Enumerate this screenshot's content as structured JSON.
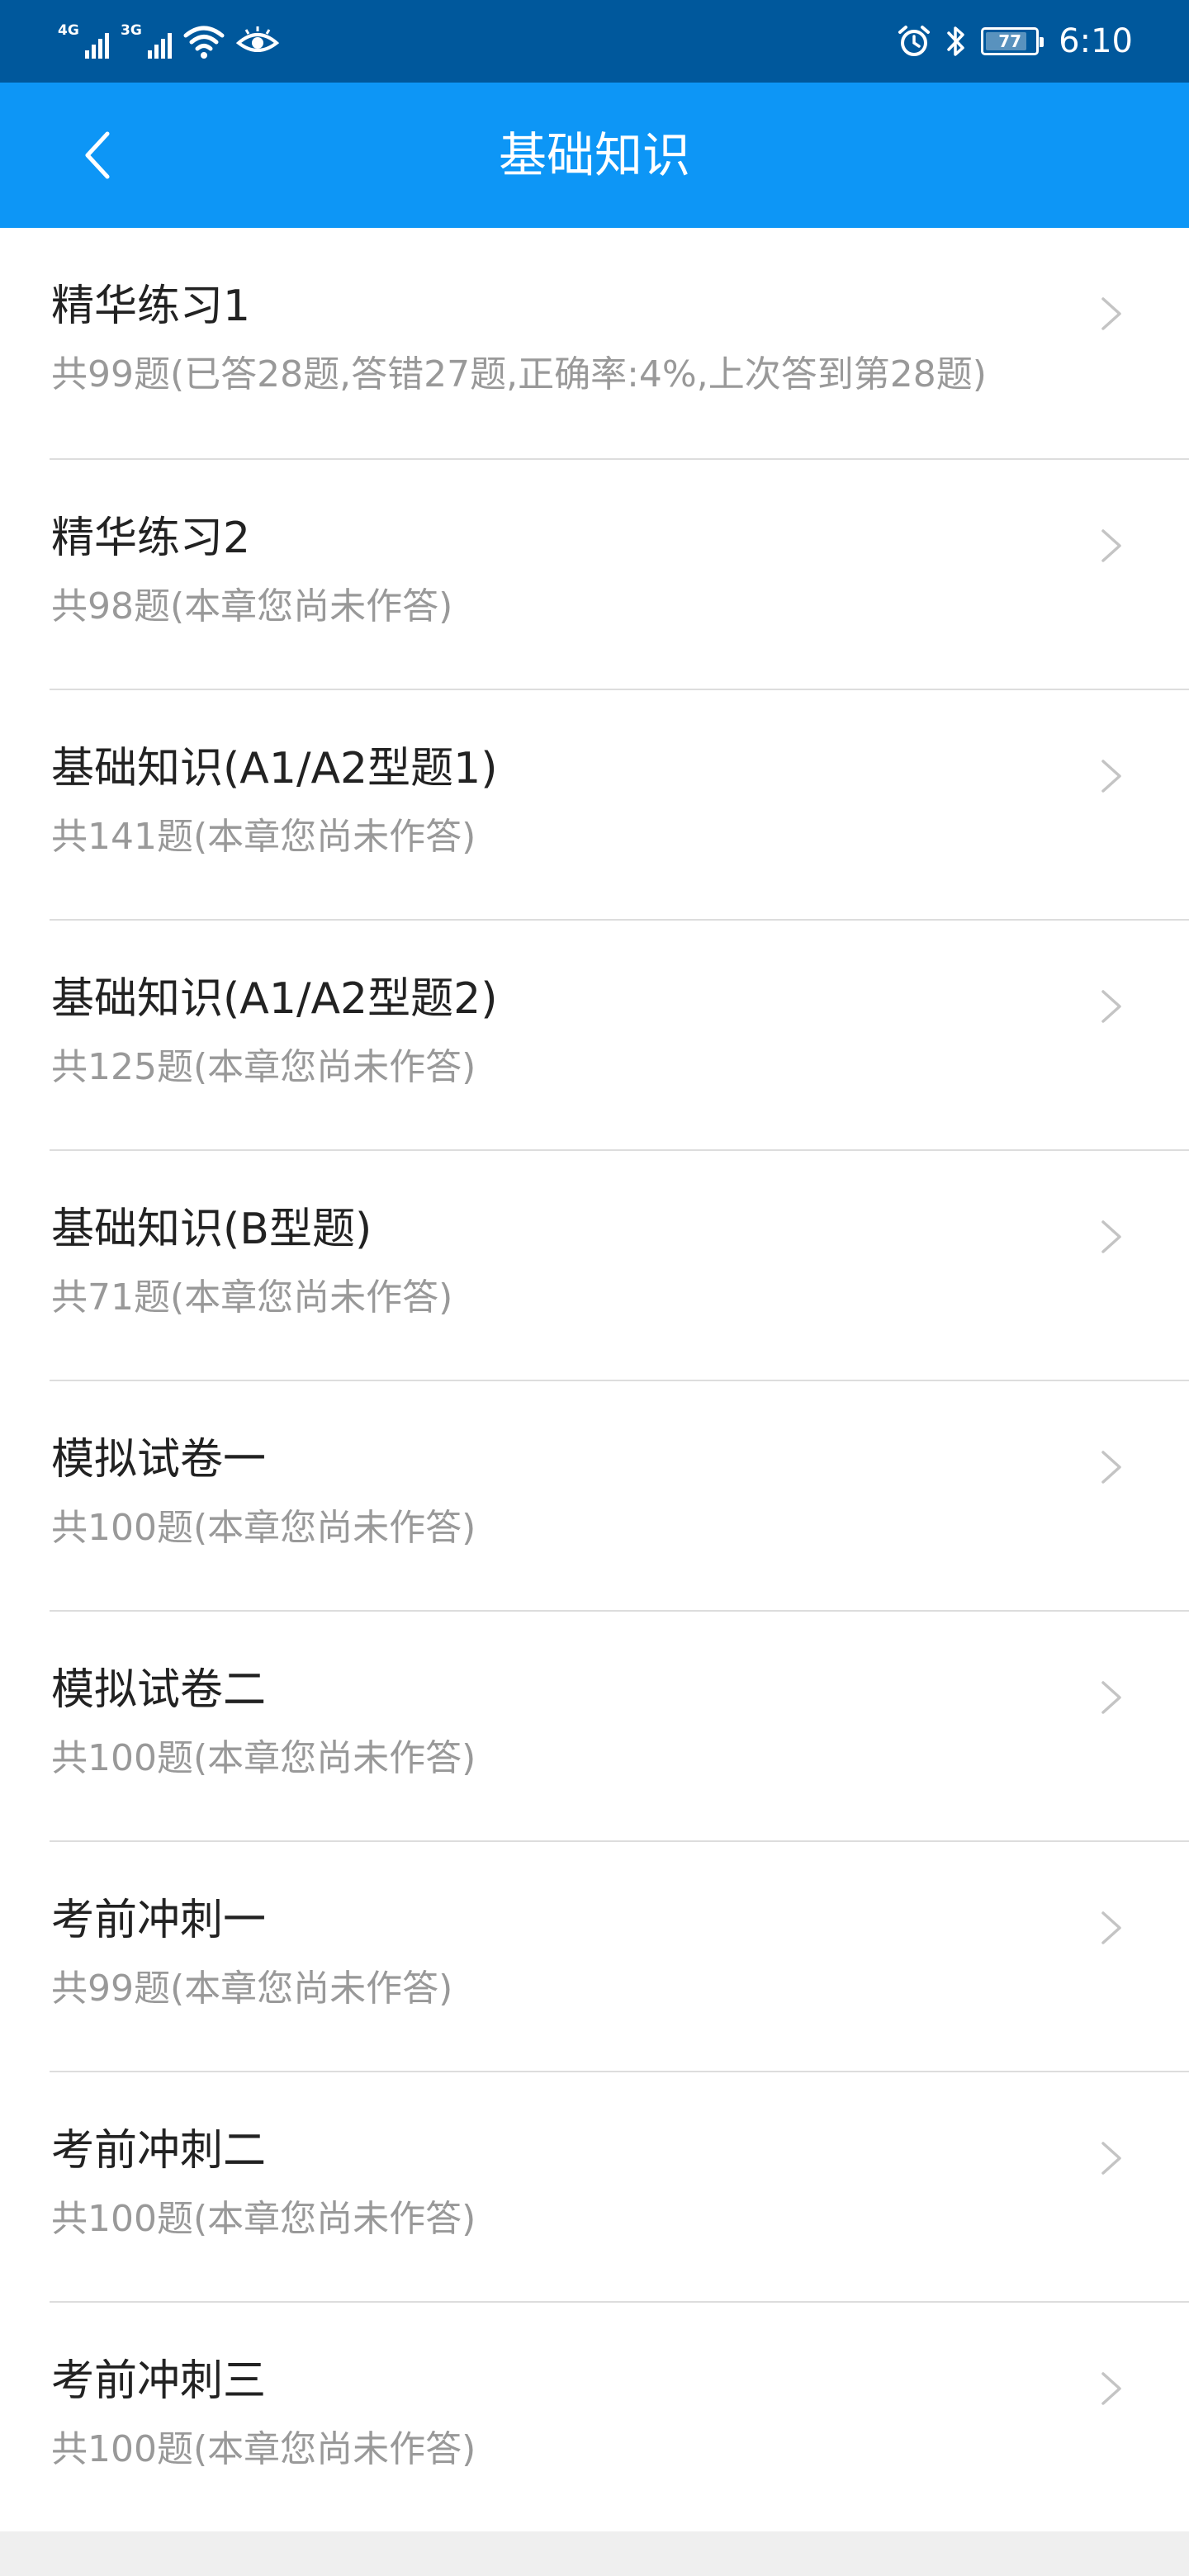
{
  "status_bar": {
    "sim1_network": "4G",
    "sim2_network": "3G",
    "battery_level": "77",
    "time": "6:10"
  },
  "header": {
    "title": "基础知识",
    "back_icon": "chevron-left-icon"
  },
  "chapters": [
    {
      "title": "精华练习1",
      "subtitle": "共99题(已答28题,答错27题,正确率:4%,上次答到第28题)"
    },
    {
      "title": "精华练习2",
      "subtitle": "共98题(本章您尚未作答)"
    },
    {
      "title": "基础知识(A1/A2型题1)",
      "subtitle": "共141题(本章您尚未作答)"
    },
    {
      "title": "基础知识(A1/A2型题2)",
      "subtitle": "共125题(本章您尚未作答)"
    },
    {
      "title": "基础知识(B型题)",
      "subtitle": "共71题(本章您尚未作答)"
    },
    {
      "title": "模拟试卷一",
      "subtitle": "共100题(本章您尚未作答)"
    },
    {
      "title": "模拟试卷二",
      "subtitle": "共100题(本章您尚未作答)"
    },
    {
      "title": "考前冲刺一",
      "subtitle": "共99题(本章您尚未作答)"
    },
    {
      "title": "考前冲刺二",
      "subtitle": "共100题(本章您尚未作答)"
    },
    {
      "title": "考前冲刺三",
      "subtitle": "共100题(本章您尚未作答)"
    }
  ],
  "colors": {
    "status_bar": "#00589c",
    "header": "#0d96f6",
    "title_text": "#222222",
    "subtitle_text": "#999999",
    "divider": "#dddddd",
    "chevron": "#c4c4c4"
  }
}
